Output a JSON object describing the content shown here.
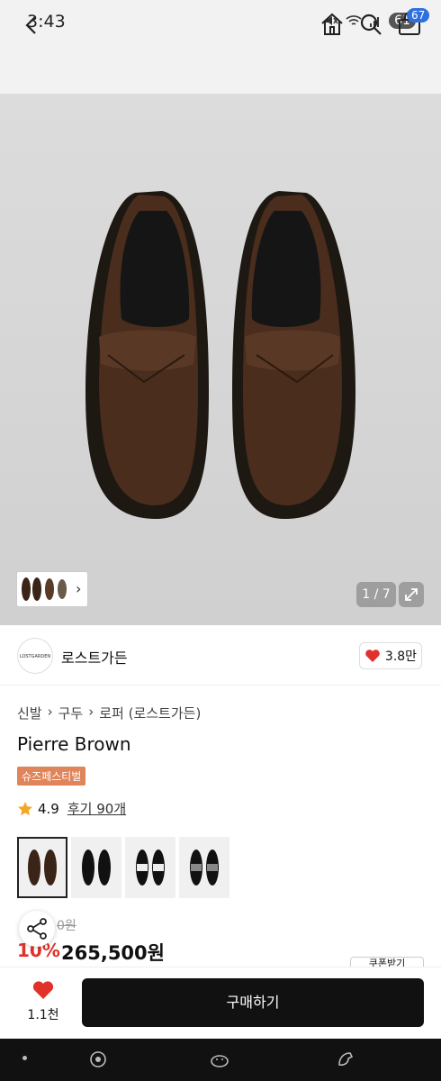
{
  "status_bar": {
    "time": "3:43",
    "battery": "61"
  },
  "nav": {
    "cart_count": "67"
  },
  "gallery": {
    "counter": "1 / 7"
  },
  "brand": {
    "logo_text": "LOSTGARDEN",
    "name": "로스트가든",
    "likes": "3.8만"
  },
  "breadcrumb": [
    "신발",
    "구두",
    "로퍼 (로스트가든)"
  ],
  "product": {
    "name": "Pierre Brown",
    "promo_badge": "슈즈페스티벌",
    "rating": "4.9",
    "review_label": "후기 90개",
    "original_price": "0원",
    "discount": "10%",
    "sale_price": "265,500원",
    "coupon_label": "쿠폰받기"
  },
  "variants": [
    "brown-suede",
    "black-leather",
    "black-white",
    "houndstooth"
  ],
  "bottom_bar": {
    "wish_count": "1.1천",
    "buy_label": "구매하기"
  },
  "colors": {
    "accent_blue": "#2f6fe0",
    "heart_red": "#e0322b",
    "promo_orange": "#e0845a",
    "buy_black": "#111111"
  }
}
